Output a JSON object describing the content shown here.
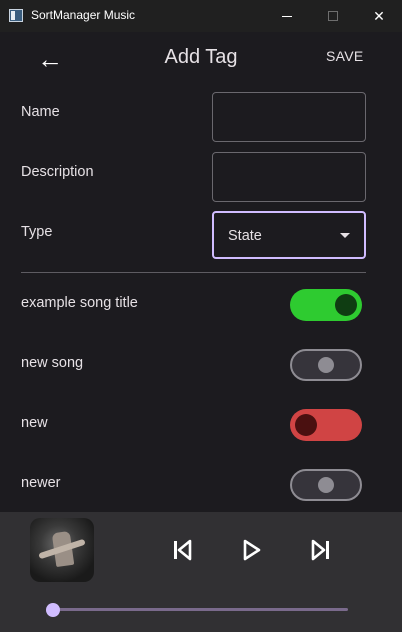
{
  "window": {
    "title": "SortManager Music",
    "close_glyph": "✕"
  },
  "appbar": {
    "back_glyph": "←",
    "title": "Add Tag",
    "save_label": "SAVE"
  },
  "form": {
    "name_label": "Name",
    "name_value": "",
    "description_label": "Description",
    "description_value": "",
    "type_label": "Type",
    "type_value": "State"
  },
  "songs": [
    {
      "title": "example song title",
      "state": "on"
    },
    {
      "title": "new song",
      "state": "neutral"
    },
    {
      "title": "new",
      "state": "off"
    },
    {
      "title": "newer",
      "state": "neutral"
    }
  ],
  "player": {
    "progress": 0.0
  },
  "colors": {
    "accent": "#d0bcff",
    "toggle_on": "#2ecb30",
    "toggle_off": "#d04444",
    "background": "#1c1b1f",
    "player_bg": "#313033"
  }
}
